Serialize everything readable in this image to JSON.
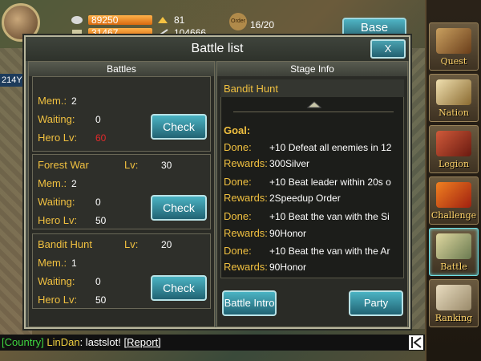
{
  "topbar": {
    "silver": "89250",
    "food_partial": "31467",
    "gold": "81",
    "other_partial": "104666",
    "order_badge": "Order",
    "order": "16/20",
    "base_button": "Base",
    "side_number": "214Y"
  },
  "dialog": {
    "title": "Battle list",
    "close_label": "X",
    "battles_header": "Battles",
    "stage_header": "Stage Info"
  },
  "battles": [
    {
      "name": "",
      "lv_label": "",
      "level": "",
      "mem_label": "Mem.:",
      "mem": "2",
      "waiting_label": "Waiting:",
      "waiting": "0",
      "hero_label": "Hero Lv:",
      "hero_lv": "60",
      "hero_lv_color": "#e02a2a",
      "button": "Check"
    },
    {
      "name": "Forest War",
      "lv_label": "Lv:",
      "level": "30",
      "mem_label": "Mem.:",
      "mem": "2",
      "waiting_label": "Waiting:",
      "waiting": "0",
      "hero_label": "Hero Lv:",
      "hero_lv": "50",
      "hero_lv_color": "#ffffff",
      "button": "Check"
    },
    {
      "name": "Bandit Hunt",
      "lv_label": "Lv:",
      "level": "20",
      "mem_label": "Mem.:",
      "mem": "1",
      "waiting_label": "Waiting:",
      "waiting": "0",
      "hero_label": "Hero Lv:",
      "hero_lv": "50",
      "hero_lv_color": "#ffffff",
      "button": "Check"
    }
  ],
  "stage": {
    "name": "Bandit Hunt",
    "goal_label": "Goal:",
    "rows": [
      {
        "key": "Done:",
        "text": "+10 Defeat all enemies in 12"
      },
      {
        "key": "Rewards:",
        "text": "300Silver"
      },
      {
        "key": "Done:",
        "text": "+10 Beat leader within 20s o"
      },
      {
        "key": "Rewards:",
        "text": "2Speedup Order"
      },
      {
        "key": "Done:",
        "text": "+10 Beat the van with the Si"
      },
      {
        "key": "Rewards:",
        "text": "90Honor"
      },
      {
        "key": "Done:",
        "text": "+10 Beat the van with the Ar"
      },
      {
        "key": "Rewards:",
        "text": "90Honor"
      }
    ],
    "battle_intro_button": "Battle Intro",
    "party_button": "Party"
  },
  "side_menu": [
    {
      "label": "Quest"
    },
    {
      "label": "Nation"
    },
    {
      "label": "Legion"
    },
    {
      "label": "Challenge"
    },
    {
      "label": "Battle"
    },
    {
      "label": "Ranking"
    }
  ],
  "chat": {
    "channel": "[Country]",
    "user": "LinDan",
    "message": ": lastslot!",
    "report": "[Report]"
  },
  "colors": {
    "gold_text": "#f0c040",
    "teal_button": "#2c7a88",
    "warning_red": "#e02a2a"
  }
}
